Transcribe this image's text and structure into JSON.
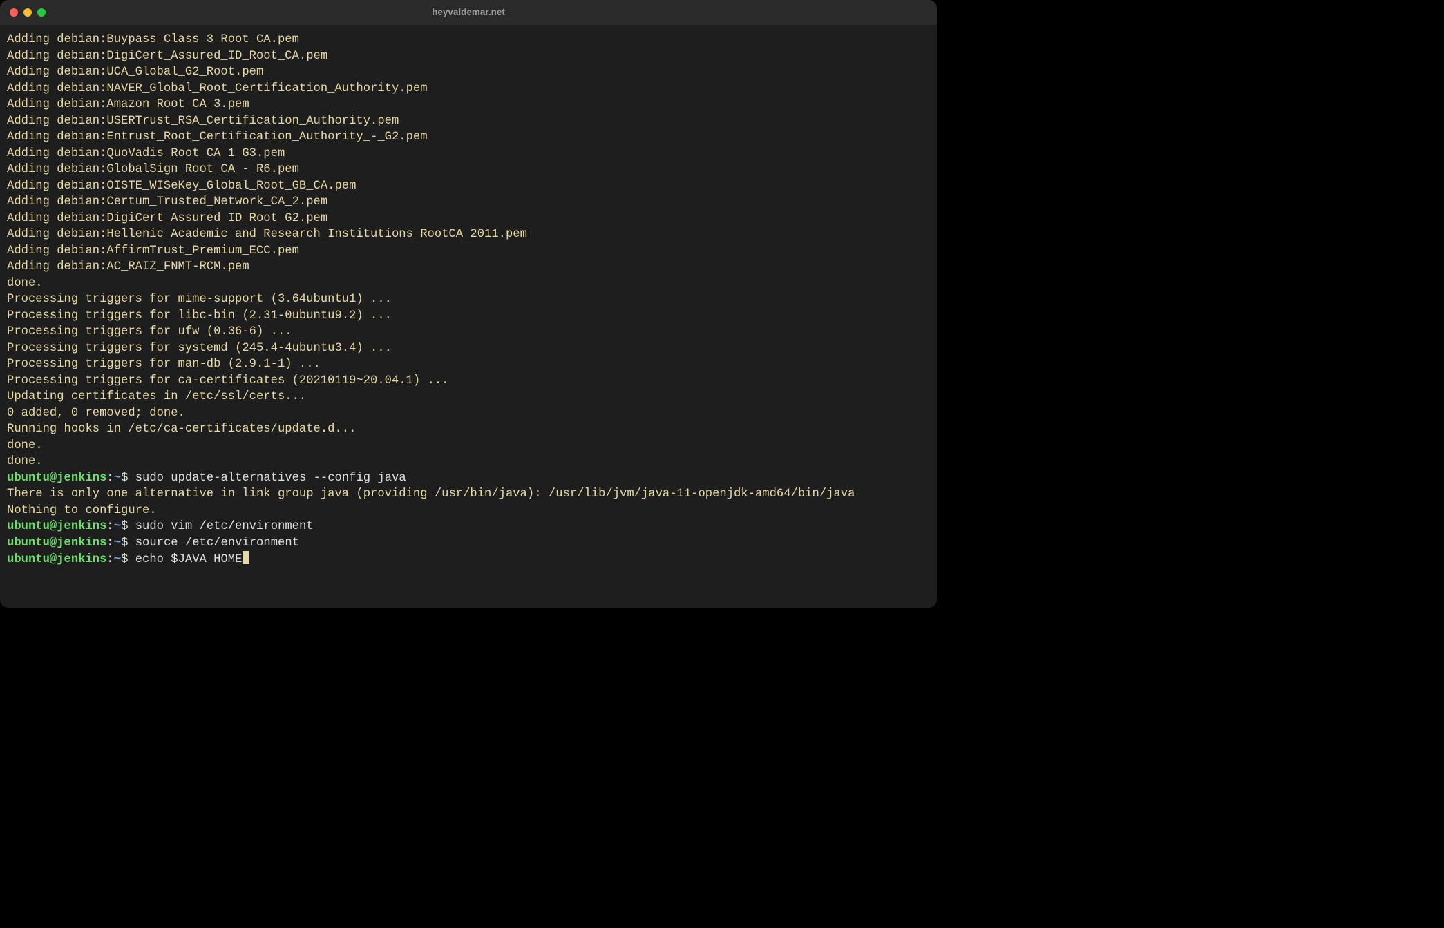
{
  "window": {
    "title": "heyvaldemar.net",
    "traffic_lights": [
      "close",
      "minimize",
      "zoom"
    ]
  },
  "colors": {
    "bg": "#1e1e1e",
    "titlebar_bg": "#2a2a2a",
    "title_text": "#9a9a9a",
    "output_text": "#e6d9a6",
    "cmd_text": "#e0e0e0",
    "prompt_user": "#6fdc6f",
    "prompt_path": "#6fa8dc",
    "traffic_red": "#ff5f57",
    "traffic_yellow": "#febc2e",
    "traffic_green": "#28c840"
  },
  "prompt": {
    "user_host": "ubuntu@jenkins",
    "path": "~",
    "symbol": "$"
  },
  "lines": [
    {
      "type": "out",
      "text": "Adding debian:Buypass_Class_3_Root_CA.pem"
    },
    {
      "type": "out",
      "text": "Adding debian:DigiCert_Assured_ID_Root_CA.pem"
    },
    {
      "type": "out",
      "text": "Adding debian:UCA_Global_G2_Root.pem"
    },
    {
      "type": "out",
      "text": "Adding debian:NAVER_Global_Root_Certification_Authority.pem"
    },
    {
      "type": "out",
      "text": "Adding debian:Amazon_Root_CA_3.pem"
    },
    {
      "type": "out",
      "text": "Adding debian:USERTrust_RSA_Certification_Authority.pem"
    },
    {
      "type": "out",
      "text": "Adding debian:Entrust_Root_Certification_Authority_-_G2.pem"
    },
    {
      "type": "out",
      "text": "Adding debian:QuoVadis_Root_CA_1_G3.pem"
    },
    {
      "type": "out",
      "text": "Adding debian:GlobalSign_Root_CA_-_R6.pem"
    },
    {
      "type": "out",
      "text": "Adding debian:OISTE_WISeKey_Global_Root_GB_CA.pem"
    },
    {
      "type": "out",
      "text": "Adding debian:Certum_Trusted_Network_CA_2.pem"
    },
    {
      "type": "out",
      "text": "Adding debian:DigiCert_Assured_ID_Root_G2.pem"
    },
    {
      "type": "out",
      "text": "Adding debian:Hellenic_Academic_and_Research_Institutions_RootCA_2011.pem"
    },
    {
      "type": "out",
      "text": "Adding debian:AffirmTrust_Premium_ECC.pem"
    },
    {
      "type": "out",
      "text": "Adding debian:AC_RAIZ_FNMT-RCM.pem"
    },
    {
      "type": "out",
      "text": "done."
    },
    {
      "type": "out",
      "text": "Processing triggers for mime-support (3.64ubuntu1) ..."
    },
    {
      "type": "out",
      "text": "Processing triggers for libc-bin (2.31-0ubuntu9.2) ..."
    },
    {
      "type": "out",
      "text": "Processing triggers for ufw (0.36-6) ..."
    },
    {
      "type": "out",
      "text": "Processing triggers for systemd (245.4-4ubuntu3.4) ..."
    },
    {
      "type": "out",
      "text": "Processing triggers for man-db (2.9.1-1) ..."
    },
    {
      "type": "out",
      "text": "Processing triggers for ca-certificates (20210119~20.04.1) ..."
    },
    {
      "type": "out",
      "text": "Updating certificates in /etc/ssl/certs..."
    },
    {
      "type": "out",
      "text": "0 added, 0 removed; done."
    },
    {
      "type": "out",
      "text": "Running hooks in /etc/ca-certificates/update.d..."
    },
    {
      "type": "out",
      "text": ""
    },
    {
      "type": "out",
      "text": "done."
    },
    {
      "type": "out",
      "text": "done."
    },
    {
      "type": "prompt",
      "cmd": "sudo update-alternatives --config java"
    },
    {
      "type": "out",
      "text": "There is only one alternative in link group java (providing /usr/bin/java): /usr/lib/jvm/java-11-openjdk-amd64/bin/java"
    },
    {
      "type": "out",
      "text": "Nothing to configure."
    },
    {
      "type": "prompt",
      "cmd": "sudo vim /etc/environment"
    },
    {
      "type": "prompt",
      "cmd": "source /etc/environment"
    },
    {
      "type": "prompt",
      "cmd": "echo $JAVA_HOME",
      "cursor": true
    }
  ]
}
